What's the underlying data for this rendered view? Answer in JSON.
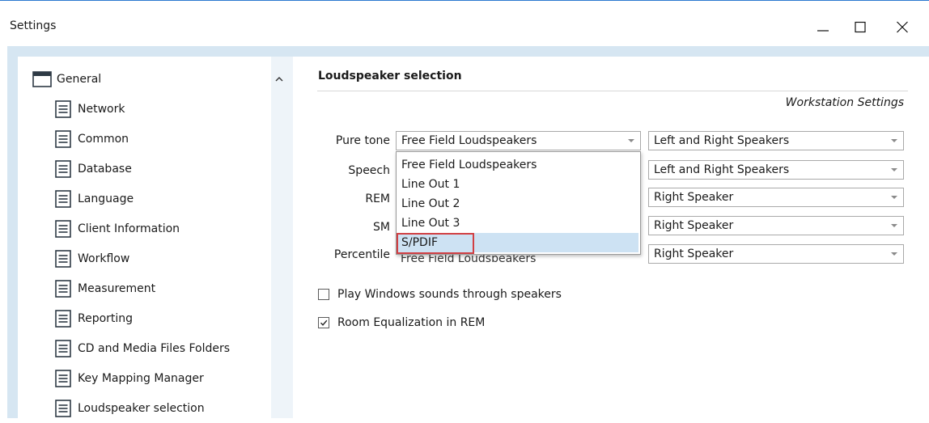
{
  "window": {
    "title": "Settings"
  },
  "nav": {
    "root": "General",
    "items": [
      "Network",
      "Common",
      "Database",
      "Language",
      "Client Information",
      "Workflow",
      "Measurement",
      "Reporting",
      "CD and Media Files Folders",
      "Key Mapping Manager",
      "Loudspeaker selection"
    ],
    "selected": "Loudspeaker selection"
  },
  "section": {
    "title": "Loudspeaker selection",
    "subtitle": "Workstation Settings"
  },
  "rows": [
    {
      "label": "Pure tone",
      "main": "Free Field Loudspeakers",
      "side": "Left and Right Speakers"
    },
    {
      "label": "Speech",
      "main": "",
      "side": "Left and Right Speakers"
    },
    {
      "label": "REM",
      "main": "",
      "side": "Right Speaker"
    },
    {
      "label": "SM",
      "main": "",
      "side": "Right Speaker"
    },
    {
      "label": "Percentile",
      "main": "Free Field Loudspeakers",
      "side": "Right Speaker"
    }
  ],
  "dropdown_options": [
    "Free Field Loudspeakers",
    "Line Out 1",
    "Line Out 2",
    "Line Out 3",
    "S/PDIF"
  ],
  "dropdown_highlighted": "S/PDIF",
  "checkboxes": [
    {
      "label": "Play Windows sounds through speakers",
      "checked": false
    },
    {
      "label": "Room Equalization in REM",
      "checked": true
    }
  ],
  "colors": {
    "frame": "#d6e6f2",
    "highlight": "#cde2f3",
    "annotation": "#d13f43",
    "title_line": "#2b79d0"
  }
}
